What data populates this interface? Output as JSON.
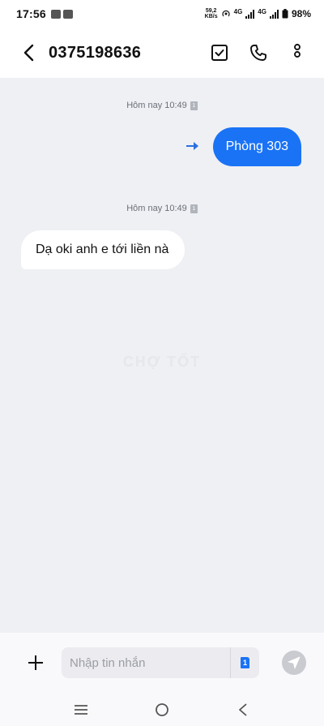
{
  "status_bar": {
    "time": "17:56",
    "speed_value": "59,2",
    "speed_unit": "KB/s",
    "network_1": "4G",
    "network_2": "4G",
    "battery": "98%"
  },
  "header": {
    "title": "0375198636"
  },
  "conversation": {
    "messages": [
      {
        "timestamp": "Hôm nay 10:49",
        "sim": "1",
        "direction": "outgoing",
        "text": "Phòng 303"
      },
      {
        "timestamp": "Hôm nay 10:49",
        "sim": "1",
        "direction": "incoming",
        "text": "Dạ oki anh e tới liền nà"
      }
    ],
    "watermark": "CHỢ TỐT"
  },
  "composer": {
    "placeholder": "Nhập tin nhắn",
    "value": "",
    "sim_label": "1"
  },
  "colors": {
    "accent": "#1a73f5",
    "chat_background": "#eff0f4",
    "incoming_bubble": "#ffffff"
  },
  "icons": {
    "back": "chevron-left-icon",
    "select": "checkbox-icon",
    "call": "phone-icon",
    "more": "more-vertical-icon",
    "add": "plus-icon",
    "send": "send-icon",
    "sent_status": "arrow-right-icon"
  }
}
